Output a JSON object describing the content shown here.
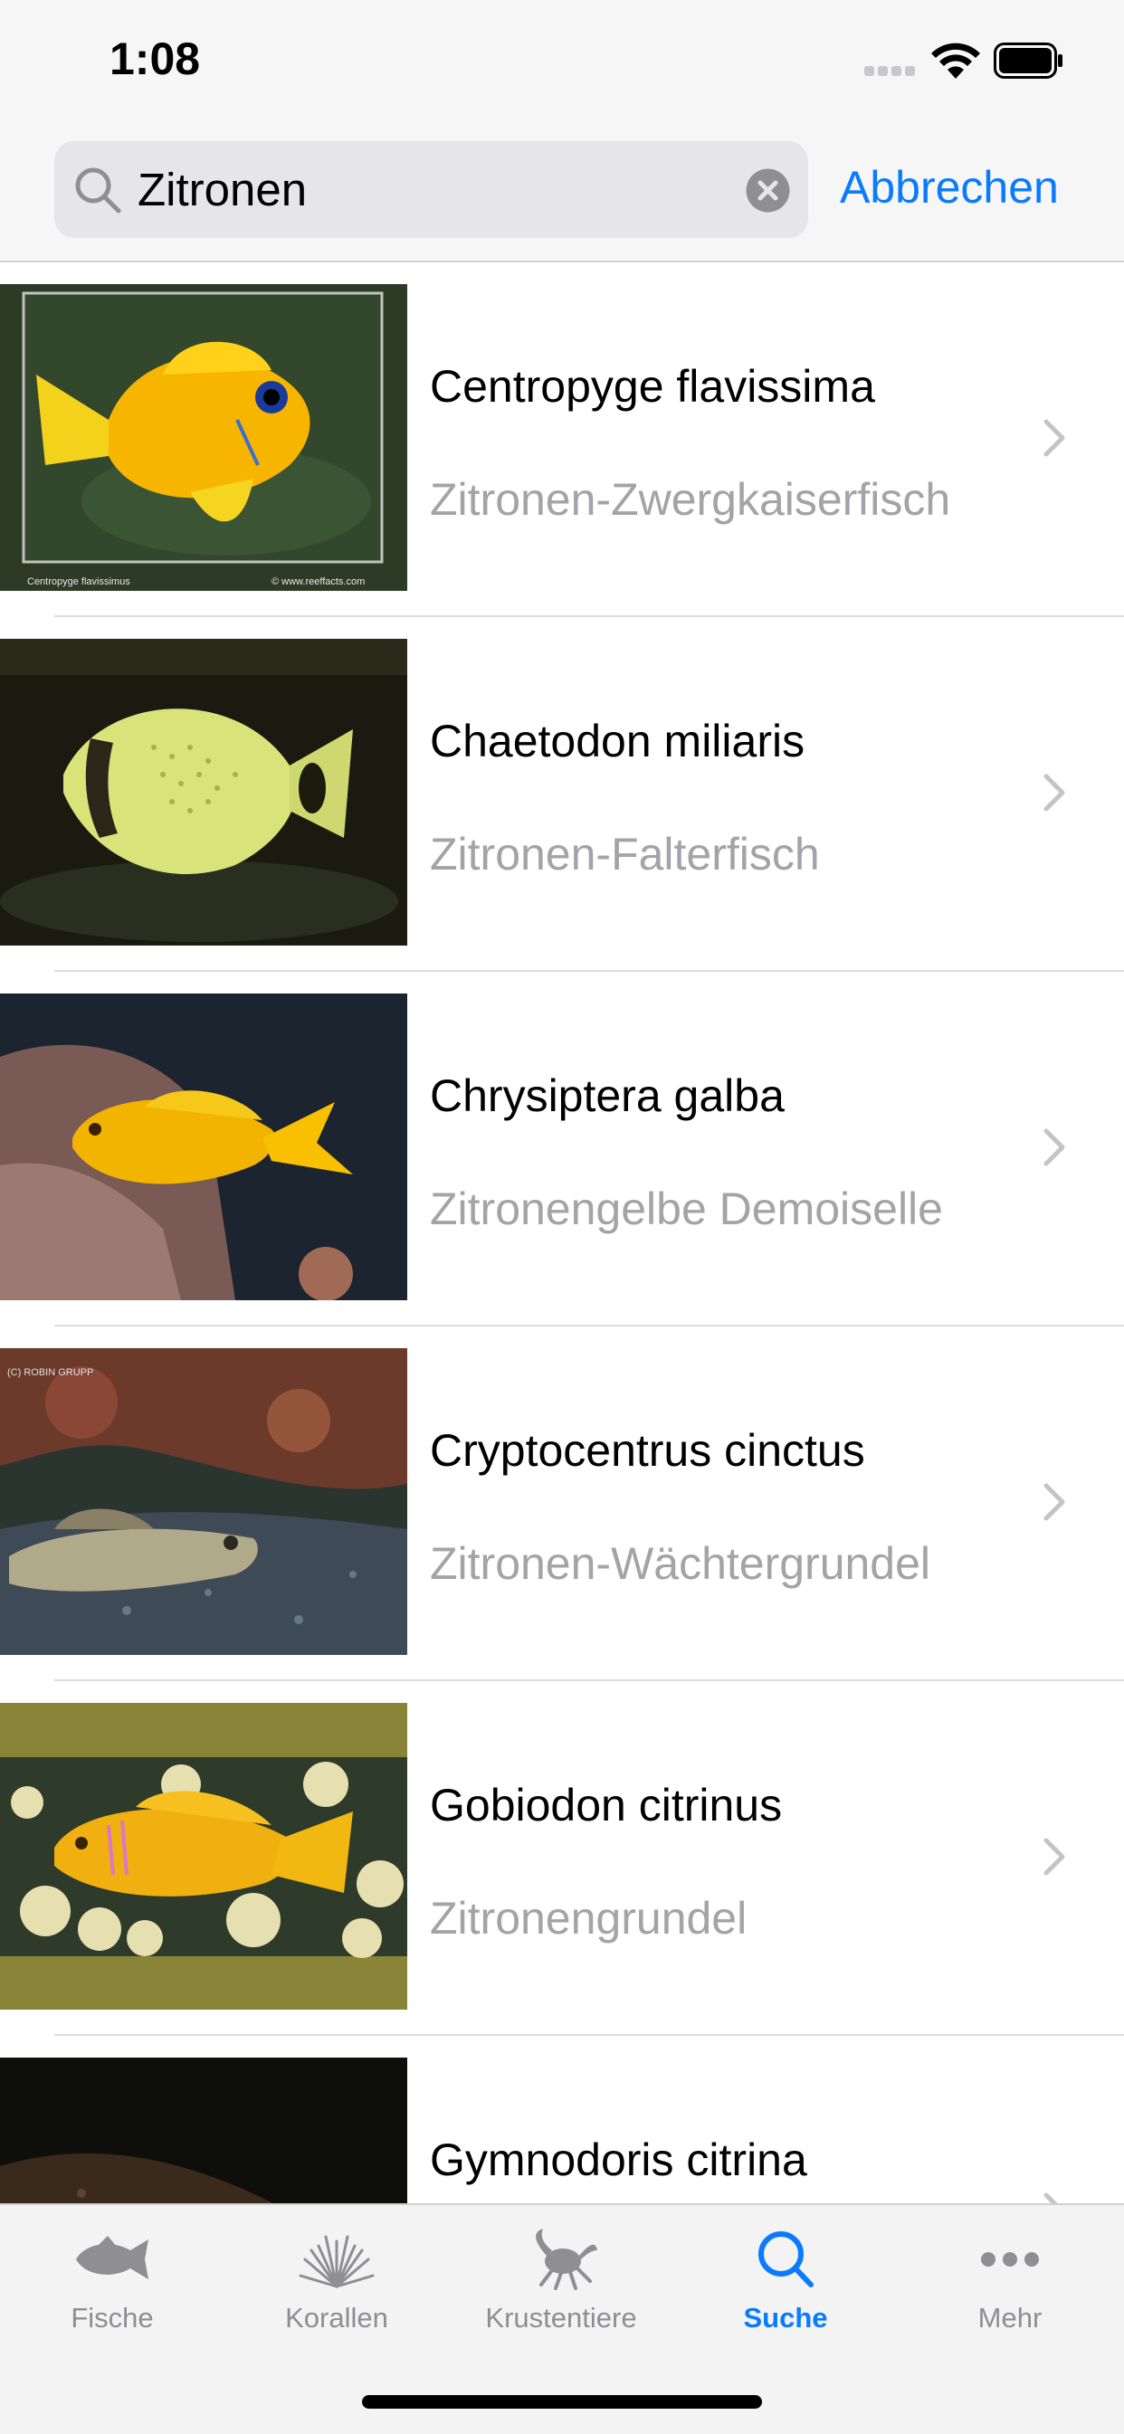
{
  "status_bar": {
    "time": "1:08"
  },
  "search": {
    "query": "Zitronen",
    "cancel_label": "Abbrechen"
  },
  "results": [
    {
      "title": "Centropyge flavissima",
      "subtitle": "Zitronen-Zwergkaiserfisch",
      "caption_left": "Centropyge flavissimus",
      "caption_right": "© www.reeffacts.com"
    },
    {
      "title": "Chaetodon miliaris",
      "subtitle": "Zitronen-Falterfisch"
    },
    {
      "title": "Chrysiptera galba",
      "subtitle": "Zitronengelbe Demoiselle"
    },
    {
      "title": "Cryptocentrus cinctus",
      "subtitle": "Zitronen-Wächtergrundel",
      "caption_left": "(C) ROBIN GRUPP"
    },
    {
      "title": "Gobiodon citrinus",
      "subtitle": "Zitronengrundel"
    },
    {
      "title": "Gymnodoris citrina",
      "subtitle": ""
    }
  ],
  "tab_bar": {
    "tabs": [
      {
        "label": "Fische",
        "icon": "fish-icon",
        "active": false
      },
      {
        "label": "Korallen",
        "icon": "coral-icon",
        "active": false
      },
      {
        "label": "Krustentiere",
        "icon": "crab-icon",
        "active": false
      },
      {
        "label": "Suche",
        "icon": "search-icon",
        "active": true
      },
      {
        "label": "Mehr",
        "icon": "more-icon",
        "active": false
      }
    ]
  },
  "colors": {
    "accent": "#0a7aff",
    "inactive_tab": "#8e8e93",
    "subtitle": "#a3a3a8"
  }
}
